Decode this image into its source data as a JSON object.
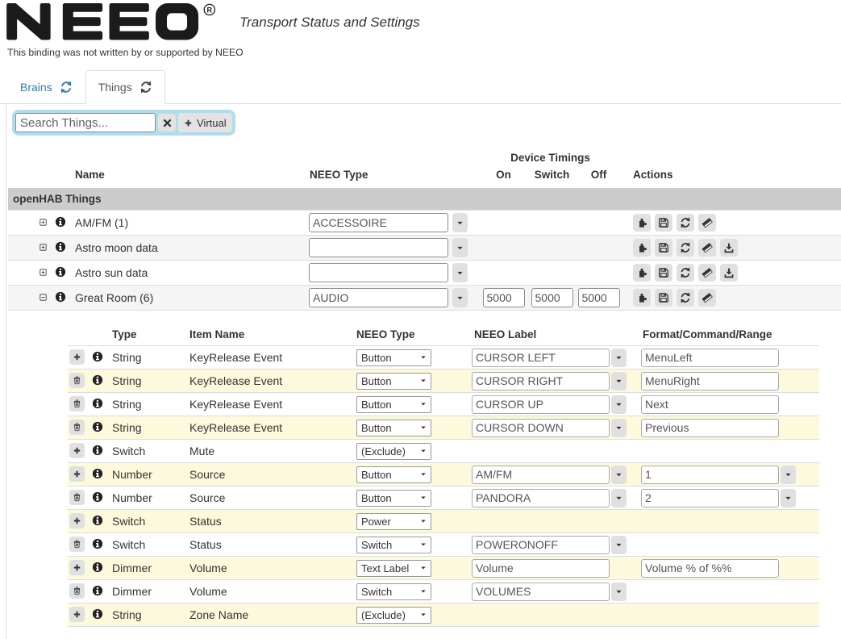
{
  "brand": {
    "logo_text": "NEEO",
    "registered_mark": "R",
    "subtitle": "Transport Status and Settings",
    "disclaimer": "This binding was not written by or supported by NEEO"
  },
  "tabs": {
    "brains": {
      "label": "Brains"
    },
    "things": {
      "label": "Things"
    }
  },
  "toolbar": {
    "search_placeholder": "Search Things...",
    "virtual_button_label": "Virtual"
  },
  "colors": {
    "accent_blue": "#337ab7",
    "search_panel_blue": "#b2dcec",
    "group_row_gray": "#cccccc",
    "stripe_gray": "#f5f5f5",
    "channel_stripe_yellow": "#fcf9dc"
  },
  "things_table": {
    "column_headers": {
      "name": "Name",
      "neeo_type": "NEEO Type",
      "device_timings": "Device Timings",
      "on": "On",
      "switch": "Switch",
      "off": "Off",
      "actions": "Actions"
    },
    "group_header": "openHAB Things",
    "rows": [
      {
        "name": "AM/FM (1)",
        "neeo_type": "ACCESSOIRE",
        "actions": [
          "puzzle-piece",
          "save",
          "refresh",
          "eraser"
        ]
      },
      {
        "name": "Astro moon data",
        "neeo_type": "",
        "actions": [
          "puzzle-piece",
          "save",
          "refresh",
          "eraser",
          "download"
        ]
      },
      {
        "name": "Astro sun data",
        "neeo_type": "",
        "actions": [
          "puzzle-piece",
          "save",
          "refresh",
          "eraser",
          "download"
        ]
      },
      {
        "name": "Great Room (6)",
        "neeo_type": "AUDIO",
        "timings": {
          "on": "5000",
          "switch": "5000",
          "off": "5000"
        },
        "actions": [
          "puzzle-piece",
          "save",
          "refresh",
          "eraser"
        ]
      }
    ]
  },
  "channels_table": {
    "column_headers": {
      "type": "Type",
      "item_name": "Item Name",
      "neeo_type": "NEEO Type",
      "neeo_label": "NEEO Label",
      "format": "Format/Command/Range"
    },
    "rows": [
      {
        "action": "add",
        "type": "String",
        "item_name": "KeyRelease Event",
        "neeo_type": "Button",
        "neeo_label": "CURSOR LEFT",
        "label_dropdown": true,
        "format": "MenuLeft",
        "format_dropdown": false
      },
      {
        "action": "delete",
        "type": "String",
        "item_name": "KeyRelease Event",
        "neeo_type": "Button",
        "neeo_label": "CURSOR RIGHT",
        "label_dropdown": true,
        "format": "MenuRight",
        "format_dropdown": false
      },
      {
        "action": "delete",
        "type": "String",
        "item_name": "KeyRelease Event",
        "neeo_type": "Button",
        "neeo_label": "CURSOR UP",
        "label_dropdown": true,
        "format": "Next",
        "format_dropdown": false
      },
      {
        "action": "delete",
        "type": "String",
        "item_name": "KeyRelease Event",
        "neeo_type": "Button",
        "neeo_label": "CURSOR DOWN",
        "label_dropdown": true,
        "format": "Previous",
        "format_dropdown": false
      },
      {
        "action": "add",
        "type": "Switch",
        "item_name": "Mute",
        "neeo_type": "(Exclude)"
      },
      {
        "action": "add",
        "type": "Number",
        "item_name": "Source",
        "neeo_type": "Button",
        "neeo_label": "AM/FM",
        "label_dropdown": true,
        "format": "1",
        "format_dropdown": true
      },
      {
        "action": "delete",
        "type": "Number",
        "item_name": "Source",
        "neeo_type": "Button",
        "neeo_label": "PANDORA",
        "label_dropdown": true,
        "format": "2",
        "format_dropdown": true
      },
      {
        "action": "add",
        "type": "Switch",
        "item_name": "Status",
        "neeo_type": "Power"
      },
      {
        "action": "delete",
        "type": "Switch",
        "item_name": "Status",
        "neeo_type": "Switch",
        "neeo_label": "POWERONOFF",
        "label_dropdown": true
      },
      {
        "action": "add",
        "type": "Dimmer",
        "item_name": "Volume",
        "neeo_type": "Text Label",
        "neeo_label": "Volume",
        "label_dropdown": false,
        "format": "Volume % of %%",
        "format_dropdown": false
      },
      {
        "action": "delete",
        "type": "Dimmer",
        "item_name": "Volume",
        "neeo_type": "Switch",
        "neeo_label": "VOLUMES",
        "label_dropdown": true
      },
      {
        "action": "add",
        "type": "String",
        "item_name": "Zone Name",
        "neeo_type": "(Exclude)"
      }
    ]
  }
}
